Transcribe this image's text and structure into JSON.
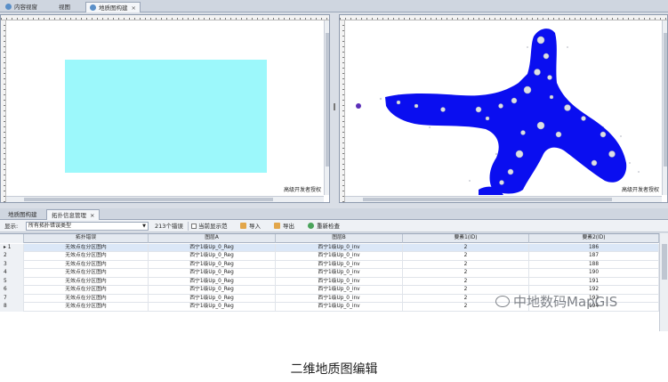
{
  "tabs": [
    {
      "label": "内容视窗",
      "active": false
    },
    {
      "label": "视图",
      "active": false
    },
    {
      "label": "地质图构建",
      "active": true
    }
  ],
  "left_map": {
    "credit": "高级开发者授权",
    "fill_color": "#9cf8fb"
  },
  "right_map": {
    "credit": "高级开发者授权",
    "fill_color": "#0a0ef0"
  },
  "bottom_tabs": [
    {
      "label": "地质图构建",
      "active": false
    },
    {
      "label": "拓扑信息管理",
      "active": true
    }
  ],
  "toolbar": {
    "show_label": "显示:",
    "filter_value": "所有拓扑错误类型",
    "error_count": "213个错误",
    "current_only": "当前显示范",
    "import": "导入",
    "export": "导出",
    "recheck": "重新检查"
  },
  "table": {
    "columns": [
      "拓扑错误",
      "图层A",
      "图层B",
      "要素1(ID)",
      "要素2(ID)"
    ],
    "rows": [
      {
        "n": "1",
        "error": "无效点在分区图内",
        "a": "西宁1级Up_0_Reg",
        "b": "西宁1级Up_0_inv",
        "id1": "2",
        "id2": "186"
      },
      {
        "n": "2",
        "error": "无效点在分区图内",
        "a": "西宁1级Up_0_Reg",
        "b": "西宁1级Up_0_inv",
        "id1": "2",
        "id2": "187"
      },
      {
        "n": "3",
        "error": "无效点在分区图内",
        "a": "西宁1级Up_0_Reg",
        "b": "西宁1级Up_0_inv",
        "id1": "2",
        "id2": "188"
      },
      {
        "n": "4",
        "error": "无效点在分区图内",
        "a": "西宁1级Up_0_Reg",
        "b": "西宁1级Up_0_inv",
        "id1": "2",
        "id2": "190"
      },
      {
        "n": "5",
        "error": "无效点在分区图内",
        "a": "西宁1级Up_0_Reg",
        "b": "西宁1级Up_0_inv",
        "id1": "2",
        "id2": "191"
      },
      {
        "n": "6",
        "error": "无效点在分区图内",
        "a": "西宁1级Up_0_Reg",
        "b": "西宁1级Up_0_inv",
        "id1": "2",
        "id2": "192"
      },
      {
        "n": "7",
        "error": "无效点在分区图内",
        "a": "西宁1级Up_0_Reg",
        "b": "西宁1级Up_0_inv",
        "id1": "2",
        "id2": "193"
      },
      {
        "n": "8",
        "error": "无效点在分区图内",
        "a": "西宁1级Up_0_Reg",
        "b": "西宁1级Up_0_inv",
        "id1": "2",
        "id2": "194"
      }
    ]
  },
  "watermark": "中地数码MapGIS",
  "caption": "二维地质图编辑"
}
